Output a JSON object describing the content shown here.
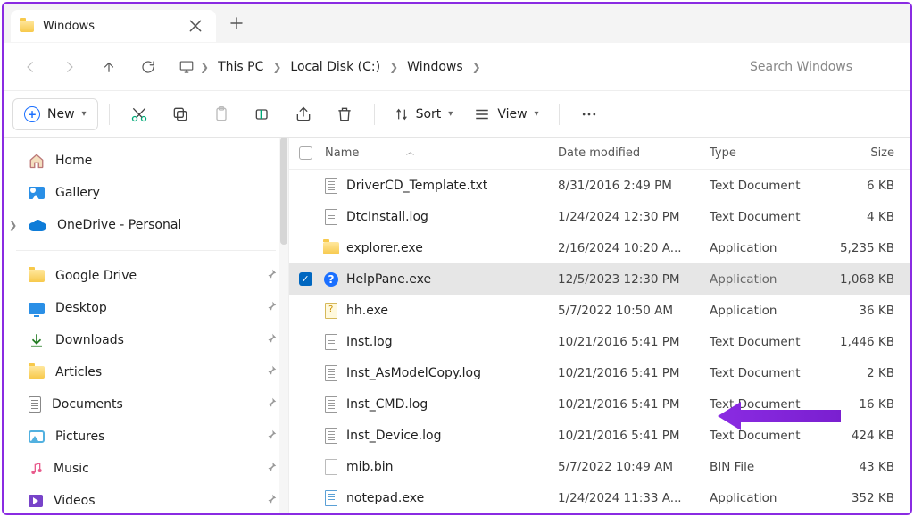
{
  "tab": {
    "title": "Windows"
  },
  "breadcrumb": {
    "pc": "This PC",
    "drive": "Local Disk (C:)",
    "folder": "Windows"
  },
  "search": {
    "placeholder": "Search Windows"
  },
  "toolbar": {
    "new": "New",
    "sort": "Sort",
    "view": "View"
  },
  "columns": {
    "name": "Name",
    "date": "Date modified",
    "type": "Type",
    "size": "Size"
  },
  "sidebar": {
    "home": "Home",
    "gallery": "Gallery",
    "onedrive": "OneDrive - Personal",
    "gdrive": "Google Drive",
    "desktop": "Desktop",
    "downloads": "Downloads",
    "articles": "Articles",
    "documents": "Documents",
    "pictures": "Pictures",
    "music": "Music",
    "videos": "Videos"
  },
  "files": [
    {
      "name": "DriverCD_Template.txt",
      "date": "8/31/2016 2:49 PM",
      "type": "Text Document",
      "size": "6 KB",
      "icon": "txt"
    },
    {
      "name": "DtcInstall.log",
      "date": "1/24/2024 12:30 PM",
      "type": "Text Document",
      "size": "4 KB",
      "icon": "txt"
    },
    {
      "name": "explorer.exe",
      "date": "2/16/2024 10:20 A...",
      "type": "Application",
      "size": "5,235 KB",
      "icon": "exe-folder"
    },
    {
      "name": "HelpPane.exe",
      "date": "12/5/2023 12:30 PM",
      "type": "Application",
      "size": "1,068 KB",
      "icon": "help",
      "selected": true
    },
    {
      "name": "hh.exe",
      "date": "5/7/2022 10:50 AM",
      "type": "Application",
      "size": "36 KB",
      "icon": "hh"
    },
    {
      "name": "Inst.log",
      "date": "10/21/2016 5:41 PM",
      "type": "Text Document",
      "size": "1,446 KB",
      "icon": "txt"
    },
    {
      "name": "Inst_AsModelCopy.log",
      "date": "10/21/2016 5:41 PM",
      "type": "Text Document",
      "size": "2 KB",
      "icon": "txt"
    },
    {
      "name": "Inst_CMD.log",
      "date": "10/21/2016 5:41 PM",
      "type": "Text Document",
      "size": "16 KB",
      "icon": "txt"
    },
    {
      "name": "Inst_Device.log",
      "date": "10/21/2016 5:41 PM",
      "type": "Text Document",
      "size": "424 KB",
      "icon": "txt"
    },
    {
      "name": "mib.bin",
      "date": "5/7/2022 10:49 AM",
      "type": "BIN File",
      "size": "43 KB",
      "icon": "bin"
    },
    {
      "name": "notepad.exe",
      "date": "1/24/2024 11:33 A...",
      "type": "Application",
      "size": "352 KB",
      "icon": "notepad"
    }
  ]
}
